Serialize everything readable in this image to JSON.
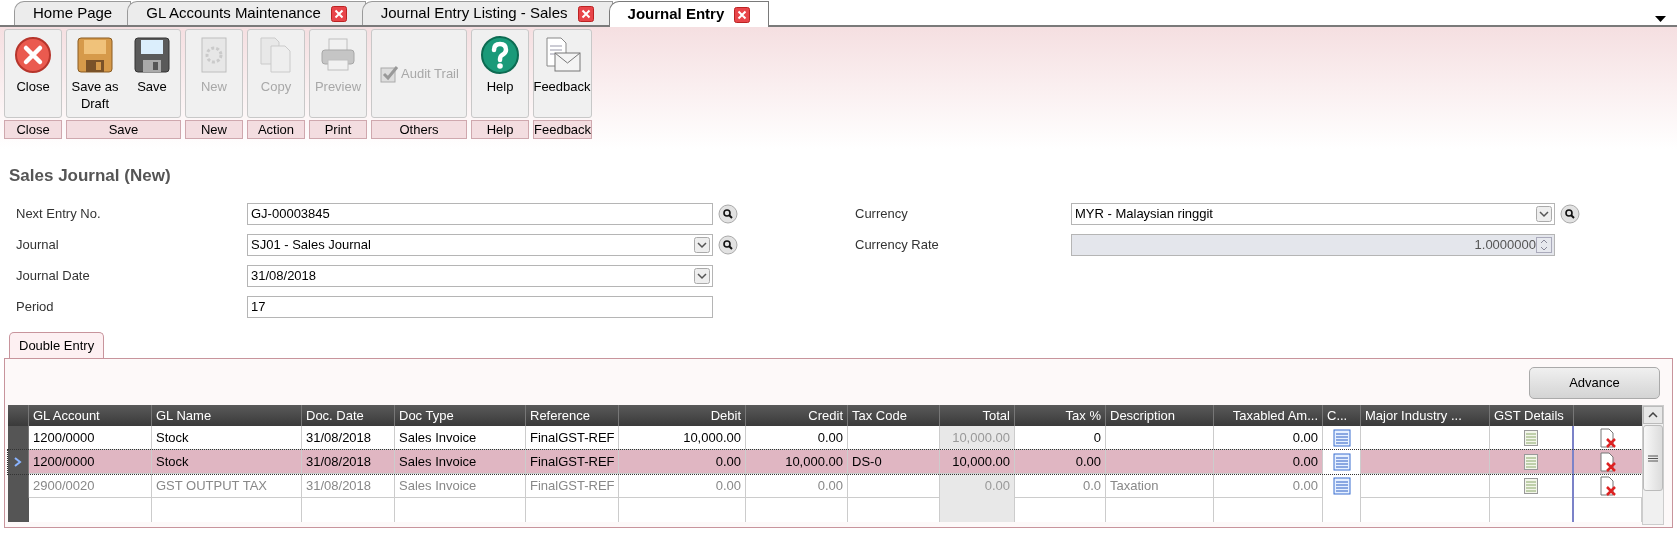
{
  "tabs": [
    {
      "label": "Home Page",
      "closable": false,
      "selected": false
    },
    {
      "label": "GL Accounts Maintenance",
      "closable": true,
      "selected": false
    },
    {
      "label": "Journal Entry Listing - Sales",
      "closable": true,
      "selected": false
    },
    {
      "label": "Journal Entry",
      "closable": true,
      "selected": true
    }
  ],
  "toolbar": [
    {
      "label": "Close",
      "buttons": [
        {
          "label": "Close",
          "kind": "close",
          "disabled": false
        }
      ]
    },
    {
      "label": "Save",
      "buttons": [
        {
          "label": "Save as Draft",
          "kind": "draft",
          "disabled": false
        },
        {
          "label": "Save",
          "kind": "save",
          "disabled": false
        }
      ]
    },
    {
      "label": "New",
      "buttons": [
        {
          "label": "New",
          "kind": "new",
          "disabled": true
        }
      ]
    },
    {
      "label": "Action",
      "buttons": [
        {
          "label": "Copy",
          "kind": "copy",
          "disabled": true
        }
      ]
    },
    {
      "label": "Print",
      "buttons": [
        {
          "label": "Preview",
          "kind": "print",
          "disabled": true
        }
      ]
    },
    {
      "label": "Others",
      "buttons": [
        {
          "label": "Audit Trail",
          "kind": "audit",
          "disabled": true
        }
      ]
    },
    {
      "label": "Help",
      "buttons": [
        {
          "label": "Help",
          "kind": "help",
          "disabled": false
        }
      ]
    },
    {
      "label": "Feedback",
      "buttons": [
        {
          "label": "Feedback",
          "kind": "feedback",
          "disabled": false
        }
      ]
    }
  ],
  "title": "Sales Journal (New)",
  "form_left": [
    {
      "label": "Next Entry No.",
      "value": "GJ-00003845",
      "kind": "lookup"
    },
    {
      "label": "Journal",
      "value": "SJ01 - Sales Journal",
      "kind": "combo-lookup"
    },
    {
      "label": "Journal Date",
      "value": "31/08/2018",
      "kind": "combo"
    },
    {
      "label": "Period",
      "value": "17",
      "kind": "text"
    }
  ],
  "form_right": [
    {
      "label": "Currency",
      "value": "MYR - Malaysian ringgit",
      "kind": "combo-lookup"
    },
    {
      "label": "Currency Rate",
      "value": "1.0000000",
      "kind": "spin"
    }
  ],
  "section_tabs": [
    {
      "label": "Double Entry",
      "selected": true
    }
  ],
  "advance_button": "Advance",
  "table": {
    "columns": [
      "GL Account",
      "GL Name",
      "Doc. Date",
      "Doc Type",
      "Reference",
      "Debit",
      "Credit",
      "Tax Code",
      "Total",
      "Tax %",
      "Description",
      "Taxabled Am...",
      "C...",
      "Major Industry ...",
      "GST Details"
    ],
    "rows": [
      {
        "selected": false,
        "greyed": false,
        "gl_account": "1200/0000",
        "gl_name": "Stock",
        "doc_date": "31/08/2018",
        "doc_type": "Sales Invoice",
        "reference": "FinalGST-REF",
        "debit": "10,000.00",
        "credit": "0.00",
        "total": "10,000.00",
        "tax_pct": "0",
        "taxabled": "0.00"
      },
      {
        "selected": true,
        "greyed": false,
        "gl_account": "1200/0000",
        "gl_name": "Stock",
        "doc_date": "31/08/2018",
        "doc_type": "Sales Invoice",
        "reference": "FinalGST-REF",
        "debit": "0.00",
        "credit": "10,000.00",
        "tax_code": "DS-0",
        "total": "10,000.00",
        "tax_pct": "0.00",
        "taxabled": "0.00"
      },
      {
        "selected": false,
        "greyed": true,
        "gl_account": "2900/0020",
        "gl_name": "GST OUTPUT TAX",
        "doc_date": "31/08/2018",
        "doc_type": "Sales Invoice",
        "reference": "FinalGST-REF",
        "debit": "0.00",
        "credit": "0.00",
        "total": "0.00",
        "tax_pct": "0.0",
        "description": "Taxation",
        "taxabled": "0.00"
      }
    ]
  }
}
